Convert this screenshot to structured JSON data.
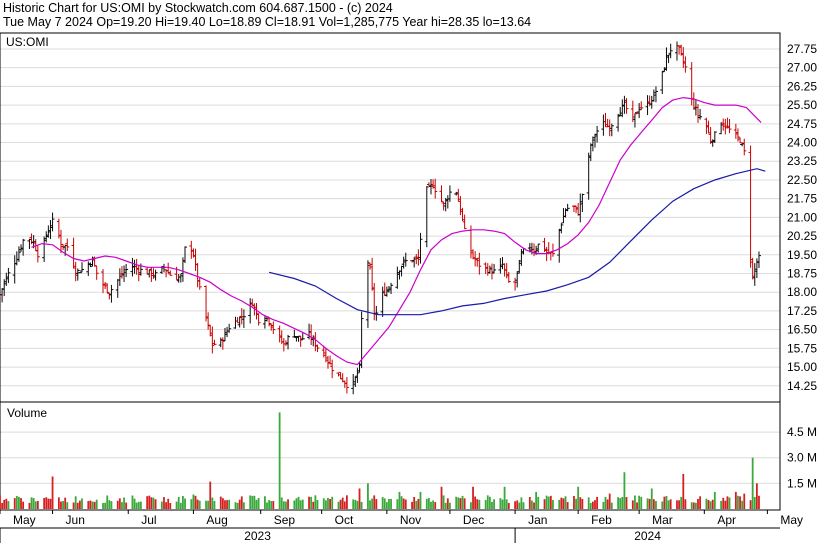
{
  "header": {
    "line1": "Historic Chart for US:OMI by Stockwatch.com 604.687.1500 - (c) 2024",
    "line2": "Tue May  7 2024   Op=19.20   Hi=19.40   Lo=18.89   Cl=18.91   Vol=1,285,775   Year hi=28.35   lo=13.64"
  },
  "chart_data": [
    {
      "type": "line",
      "panel": "price",
      "label": "US:OMI",
      "yticks": [
        "27.75",
        "27.00",
        "26.25",
        "25.50",
        "24.75",
        "24.00",
        "23.25",
        "22.50",
        "21.75",
        "21.00",
        "20.25",
        "19.50",
        "18.75",
        "18.00",
        "17.25",
        "16.50",
        "15.75",
        "15.00",
        "14.25"
      ],
      "ylim": [
        13.64,
        28.35
      ],
      "months": [
        {
          "label": "May",
          "day": 0
        },
        {
          "label": "Jun",
          "day": 25
        },
        {
          "label": "Jul",
          "day": 61
        },
        {
          "label": "Aug",
          "day": 92
        },
        {
          "label": "Sep",
          "day": 124
        },
        {
          "label": "Oct",
          "day": 153
        },
        {
          "label": "Nov",
          "day": 184
        },
        {
          "label": "Dec",
          "day": 214
        },
        {
          "label": "Jan",
          "day": 245
        },
        {
          "label": "Feb",
          "day": 275
        },
        {
          "label": "Mar",
          "day": 304
        },
        {
          "label": "Apr",
          "day": 335
        },
        {
          "label": "May",
          "day": 365
        }
      ],
      "years": [
        {
          "label": "2023",
          "from": 0,
          "to": 245
        },
        {
          "label": "2024",
          "from": 245,
          "to": 371
        }
      ],
      "close_keypoints": [
        [
          0,
          17.9
        ],
        [
          2,
          18.4
        ],
        [
          8,
          19.4
        ],
        [
          12,
          20.3
        ],
        [
          16,
          20.0
        ],
        [
          19,
          19.3
        ],
        [
          22,
          20.3
        ],
        [
          26,
          21.0
        ],
        [
          29,
          19.9
        ],
        [
          33,
          19.8
        ],
        [
          36,
          18.8
        ],
        [
          39,
          18.9
        ],
        [
          44,
          19.3
        ],
        [
          47,
          18.5
        ],
        [
          52,
          18.0
        ],
        [
          57,
          18.6
        ],
        [
          62,
          19.1
        ],
        [
          66,
          18.9
        ],
        [
          70,
          18.8
        ],
        [
          74,
          18.7
        ],
        [
          78,
          19.0
        ],
        [
          82,
          18.6
        ],
        [
          86,
          18.6
        ],
        [
          89,
          20.3
        ],
        [
          92,
          19.5
        ],
        [
          94,
          18.5
        ],
        [
          97,
          17.3
        ],
        [
          101,
          15.9
        ],
        [
          105,
          16.0
        ],
        [
          109,
          16.6
        ],
        [
          113,
          16.9
        ],
        [
          116,
          17.1
        ],
        [
          120,
          17.6
        ],
        [
          123,
          16.9
        ],
        [
          127,
          17.0
        ],
        [
          131,
          16.4
        ],
        [
          135,
          15.9
        ],
        [
          139,
          16.4
        ],
        [
          143,
          16.1
        ],
        [
          147,
          16.3
        ],
        [
          151,
          15.8
        ],
        [
          155,
          15.4
        ],
        [
          159,
          14.8
        ],
        [
          163,
          14.5
        ],
        [
          166,
          14.2
        ],
        [
          168,
          14.3
        ],
        [
          171,
          15.0
        ],
        [
          172,
          16.9
        ],
        [
          174,
          19.5
        ],
        [
          176,
          18.9
        ],
        [
          178,
          17.2
        ],
        [
          180,
          17.1
        ],
        [
          182,
          17.9
        ],
        [
          185,
          18.2
        ],
        [
          188,
          18.7
        ],
        [
          192,
          19.2
        ],
        [
          195,
          19.3
        ],
        [
          199,
          19.3
        ],
        [
          201,
          21.0
        ],
        [
          203,
          22.1
        ],
        [
          206,
          22.3
        ],
        [
          209,
          21.8
        ],
        [
          211,
          21.5
        ],
        [
          214,
          22.0
        ],
        [
          216,
          22.4
        ],
        [
          219,
          21.3
        ],
        [
          222,
          20.0
        ],
        [
          225,
          19.4
        ],
        [
          228,
          19.1
        ],
        [
          232,
          18.9
        ],
        [
          236,
          18.8
        ],
        [
          239,
          19.1
        ],
        [
          241,
          18.6
        ],
        [
          243,
          18.2
        ],
        [
          245,
          18.4
        ],
        [
          248,
          19.5
        ],
        [
          251,
          19.9
        ],
        [
          254,
          19.7
        ],
        [
          257,
          20.0
        ],
        [
          260,
          19.6
        ],
        [
          263,
          19.5
        ],
        [
          266,
          20.5
        ],
        [
          269,
          21.3
        ],
        [
          272,
          21.5
        ],
        [
          275,
          21.2
        ],
        [
          278,
          22.3
        ],
        [
          281,
          23.9
        ],
        [
          283,
          24.3
        ],
        [
          286,
          24.8
        ],
        [
          290,
          24.6
        ],
        [
          294,
          25.2
        ],
        [
          297,
          25.5
        ],
        [
          301,
          24.9
        ],
        [
          304,
          25.4
        ],
        [
          308,
          25.5
        ],
        [
          311,
          25.9
        ],
        [
          314,
          26.4
        ],
        [
          317,
          27.4
        ],
        [
          320,
          27.9
        ],
        [
          323,
          27.7
        ],
        [
          326,
          27.0
        ],
        [
          329,
          25.7
        ],
        [
          332,
          25.1
        ],
        [
          335,
          24.9
        ],
        [
          338,
          24.1
        ],
        [
          341,
          24.4
        ],
        [
          343,
          24.8
        ],
        [
          346,
          24.6
        ],
        [
          349,
          24.3
        ],
        [
          352,
          24.1
        ],
        [
          354,
          23.6
        ],
        [
          356,
          20.2
        ],
        [
          358,
          18.6
        ],
        [
          360,
          19.2
        ],
        [
          362,
          19.5
        ]
      ],
      "series": [
        {
          "name": "",
          "color": "#cc00cc",
          "values": [
            [
              15,
              19.8
            ],
            [
              20,
              19.95
            ],
            [
              25,
              19.9
            ],
            [
              30,
              19.6
            ],
            [
              35,
              19.35
            ],
            [
              40,
              19.25
            ],
            [
              45,
              19.35
            ],
            [
              50,
              19.45
            ],
            [
              55,
              19.4
            ],
            [
              60,
              19.25
            ],
            [
              65,
              19.1
            ],
            [
              70,
              19.0
            ],
            [
              75,
              19.0
            ],
            [
              80,
              19.0
            ],
            [
              85,
              18.9
            ],
            [
              90,
              18.75
            ],
            [
              95,
              18.6
            ],
            [
              100,
              18.4
            ],
            [
              105,
              18.1
            ],
            [
              110,
              17.85
            ],
            [
              115,
              17.65
            ],
            [
              120,
              17.4
            ],
            [
              125,
              17.1
            ],
            [
              130,
              16.9
            ],
            [
              135,
              16.75
            ],
            [
              140,
              16.55
            ],
            [
              145,
              16.35
            ],
            [
              150,
              16.1
            ],
            [
              155,
              15.75
            ],
            [
              160,
              15.45
            ],
            [
              165,
              15.2
            ],
            [
              170,
              15.1
            ],
            [
              175,
              15.6
            ],
            [
              180,
              16.1
            ],
            [
              185,
              16.6
            ],
            [
              190,
              17.3
            ],
            [
              195,
              18.0
            ],
            [
              200,
              18.9
            ],
            [
              205,
              19.7
            ],
            [
              210,
              20.1
            ],
            [
              215,
              20.35
            ],
            [
              220,
              20.45
            ],
            [
              225,
              20.5
            ],
            [
              230,
              20.5
            ],
            [
              235,
              20.45
            ],
            [
              240,
              20.35
            ],
            [
              245,
              20.0
            ],
            [
              250,
              19.7
            ],
            [
              255,
              19.55
            ],
            [
              260,
              19.55
            ],
            [
              265,
              19.7
            ],
            [
              270,
              19.95
            ],
            [
              275,
              20.3
            ],
            [
              280,
              20.8
            ],
            [
              285,
              21.5
            ],
            [
              290,
              22.4
            ],
            [
              295,
              23.3
            ],
            [
              300,
              23.9
            ],
            [
              305,
              24.4
            ],
            [
              310,
              24.9
            ],
            [
              315,
              25.4
            ],
            [
              320,
              25.7
            ],
            [
              325,
              25.8
            ],
            [
              330,
              25.75
            ],
            [
              335,
              25.6
            ],
            [
              340,
              25.5
            ],
            [
              345,
              25.5
            ],
            [
              350,
              25.5
            ],
            [
              355,
              25.4
            ],
            [
              362,
              24.8
            ]
          ]
        },
        {
          "name": "",
          "color": "#1a1aaa",
          "values": [
            [
              128,
              18.8
            ],
            [
              140,
              18.55
            ],
            [
              150,
              18.25
            ],
            [
              160,
              17.75
            ],
            [
              170,
              17.3
            ],
            [
              180,
              17.1
            ],
            [
              190,
              17.1
            ],
            [
              200,
              17.1
            ],
            [
              210,
              17.25
            ],
            [
              220,
              17.45
            ],
            [
              230,
              17.55
            ],
            [
              240,
              17.75
            ],
            [
              250,
              17.9
            ],
            [
              260,
              18.05
            ],
            [
              270,
              18.3
            ],
            [
              280,
              18.6
            ],
            [
              290,
              19.2
            ],
            [
              300,
              20.05
            ],
            [
              310,
              20.9
            ],
            [
              320,
              21.65
            ],
            [
              330,
              22.15
            ],
            [
              340,
              22.5
            ],
            [
              350,
              22.75
            ],
            [
              355,
              22.85
            ],
            [
              360,
              22.95
            ],
            [
              364,
              22.85
            ]
          ]
        }
      ]
    },
    {
      "type": "bar",
      "panel": "volume",
      "label": "Volume",
      "yticks": [
        "4.5 M",
        "3.0 M",
        "1.5 M"
      ],
      "ylim": [
        0,
        6.2
      ],
      "spikes": [
        [
          0,
          0.8
        ],
        [
          12,
          0.95
        ],
        [
          25,
          1.9
        ],
        [
          40,
          0.65
        ],
        [
          55,
          0.75
        ],
        [
          70,
          0.75
        ],
        [
          80,
          0.6
        ],
        [
          92,
          0.85
        ],
        [
          100,
          1.6
        ],
        [
          110,
          0.75
        ],
        [
          124,
          0.8
        ],
        [
          133,
          5.65
        ],
        [
          140,
          0.5
        ],
        [
          150,
          0.8
        ],
        [
          160,
          0.8
        ],
        [
          165,
          0.8
        ],
        [
          171,
          1.2
        ],
        [
          175,
          1.5
        ],
        [
          190,
          1.0
        ],
        [
          200,
          1.0
        ],
        [
          210,
          1.3
        ],
        [
          215,
          2.2
        ],
        [
          225,
          1.3
        ],
        [
          230,
          1.0
        ],
        [
          240,
          1.3
        ],
        [
          255,
          1.0
        ],
        [
          265,
          0.95
        ],
        [
          275,
          1.3
        ],
        [
          290,
          0.9
        ],
        [
          297,
          2.15
        ],
        [
          310,
          1.2
        ],
        [
          325,
          2.05
        ],
        [
          340,
          1.0
        ],
        [
          350,
          1.0
        ],
        [
          354,
          0.9
        ],
        [
          356,
          2.2
        ],
        [
          358,
          3.0
        ],
        [
          360,
          1.5
        ],
        [
          362,
          1.28
        ]
      ]
    }
  ]
}
